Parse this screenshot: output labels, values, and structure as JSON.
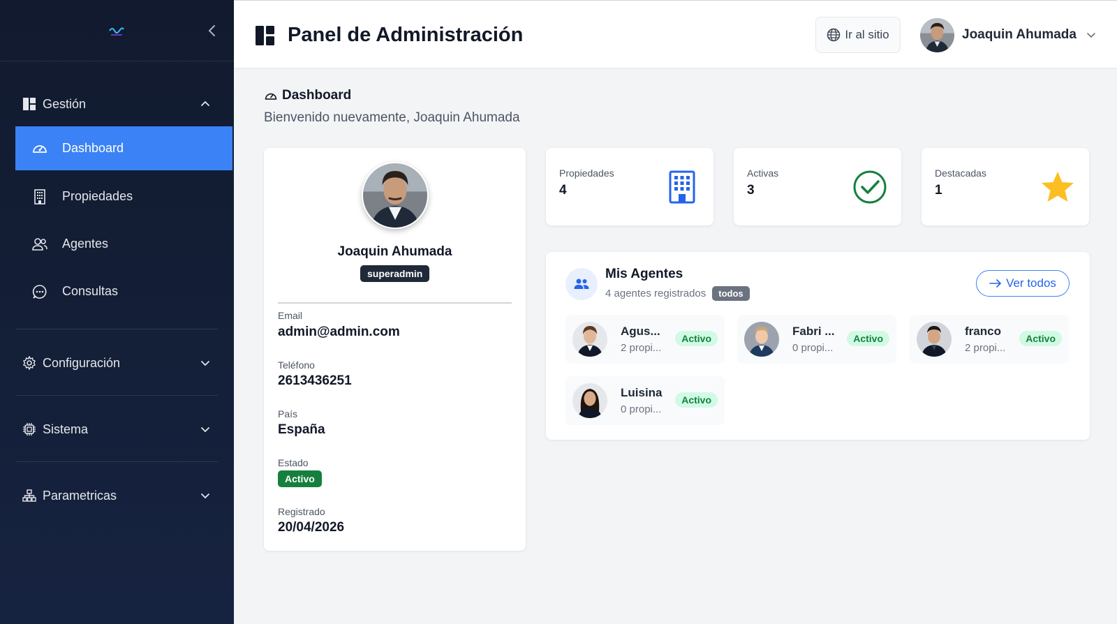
{
  "header": {
    "title": "Panel de Administración",
    "site_button": "Ir al sitio",
    "user_name": "Joaquin Ahumada"
  },
  "sidebar": {
    "sections": [
      {
        "label": "Gestión",
        "icon": "layout-icon",
        "expanded": true
      },
      {
        "label": "Configuración",
        "icon": "gear-icon",
        "expanded": false
      },
      {
        "label": "Sistema",
        "icon": "chip-icon",
        "expanded": false
      },
      {
        "label": "Parametricas",
        "icon": "hierarchy-icon",
        "expanded": false
      }
    ],
    "items": [
      {
        "label": "Dashboard",
        "icon": "speedometer-icon",
        "active": true
      },
      {
        "label": "Propiedades",
        "icon": "building-icon",
        "active": false
      },
      {
        "label": "Agentes",
        "icon": "people-icon",
        "active": false
      },
      {
        "label": "Consultas",
        "icon": "chat-icon",
        "active": false
      }
    ]
  },
  "page": {
    "title": "Dashboard",
    "welcome": "Bienvenido nuevamente, Joaquin Ahumada"
  },
  "profile": {
    "name": "Joaquin Ahumada",
    "role": "superadmin",
    "fields": [
      {
        "label": "Email",
        "value": "admin@admin.com"
      },
      {
        "label": "Teléfono",
        "value": "2613436251"
      },
      {
        "label": "País",
        "value": "España"
      },
      {
        "label": "Estado",
        "value": "Activo"
      },
      {
        "label": "Registrado",
        "value": "20/04/2026"
      }
    ]
  },
  "stats": [
    {
      "label": "Propiedades",
      "value": "4",
      "icon": "building-icon",
      "color": "#2563eb"
    },
    {
      "label": "Activas",
      "value": "3",
      "icon": "check-circle-icon",
      "color": "#15803d"
    },
    {
      "label": "Destacadas",
      "value": "1",
      "icon": "star-icon",
      "color": "#fbbf24"
    }
  ],
  "agents": {
    "title": "Mis Agentes",
    "subtitle": "4 agentes registrados",
    "filter_badge": "todos",
    "view_all": "Ver todos",
    "list": [
      {
        "name": "Agus...",
        "props": "2 propi...",
        "status": "Activo"
      },
      {
        "name": "Fabri ...",
        "props": "0 propi...",
        "status": "Activo"
      },
      {
        "name": "franco",
        "props": "2 propi...",
        "status": "Activo"
      },
      {
        "name": "Luisina",
        "props": "0 propi...",
        "status": "Activo"
      }
    ]
  },
  "colors": {
    "sidebar_bg": "#111a2e",
    "accent": "#3b82f6",
    "success": "#15803d"
  }
}
